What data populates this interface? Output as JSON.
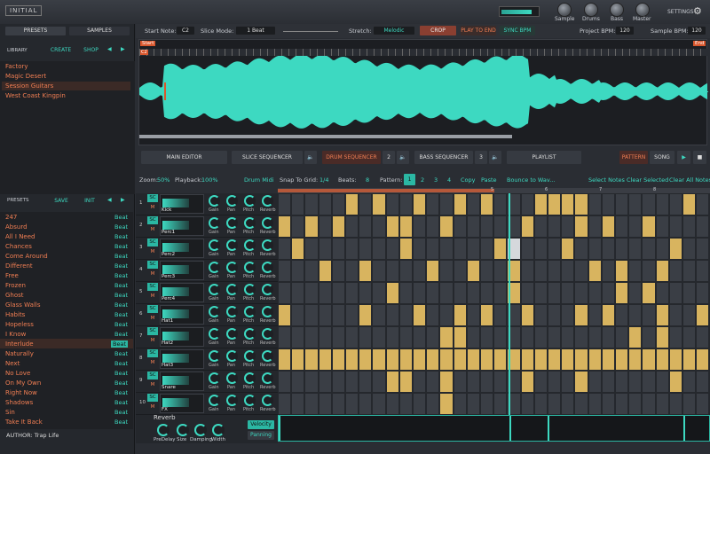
{
  "brand": "INITIAL",
  "header": {
    "knobs": [
      "Sample",
      "Drums",
      "Bass",
      "Master"
    ],
    "settings": "SETTINGS"
  },
  "left": {
    "tab_presets": "PRESETS",
    "tab_samples": "SAMPLES",
    "library_label": "LIBRARY",
    "create": "CREATE",
    "shop": "SHOP",
    "library": [
      "Factory",
      "Magic Desert",
      "Session Guitars",
      "West Coast Kingpin"
    ],
    "presets_label": "PRESETS",
    "save": "SAVE",
    "init": "INIT",
    "presets": [
      {
        "n": "247",
        "t": "Beat"
      },
      {
        "n": "Absurd",
        "t": "Beat"
      },
      {
        "n": "All I Need",
        "t": "Beat"
      },
      {
        "n": "Chances",
        "t": "Beat"
      },
      {
        "n": "Come Around",
        "t": "Beat"
      },
      {
        "n": "Different",
        "t": "Beat"
      },
      {
        "n": "Free",
        "t": "Beat"
      },
      {
        "n": "Frozen",
        "t": "Beat"
      },
      {
        "n": "Ghost",
        "t": "Beat"
      },
      {
        "n": "Glass Walls",
        "t": "Beat"
      },
      {
        "n": "Habits",
        "t": "Beat"
      },
      {
        "n": "Hopeless",
        "t": "Beat"
      },
      {
        "n": "I Know",
        "t": "Beat"
      },
      {
        "n": "Interlude",
        "t": "Beat"
      },
      {
        "n": "Naturally",
        "t": "Beat"
      },
      {
        "n": "Next",
        "t": "Beat"
      },
      {
        "n": "No Love",
        "t": "Beat"
      },
      {
        "n": "On My Own",
        "t": "Beat"
      },
      {
        "n": "Right Now",
        "t": "Beat"
      },
      {
        "n": "Shadows",
        "t": "Beat"
      },
      {
        "n": "Sin",
        "t": "Beat"
      },
      {
        "n": "Take It Back",
        "t": "Beat"
      }
    ],
    "author": "AUTHOR: Trap Life"
  },
  "toolbar": {
    "start_note_label": "Start Note:",
    "start_note": "C2",
    "slice_mode_label": "Slice Mode:",
    "slice_mode": "1 Beat",
    "stretch_label": "Stretch:",
    "stretch": "Melodic",
    "crop": "CROP",
    "play_to_end": "PLAY TO END",
    "sync_bpm": "SYNC BPM",
    "project_bpm_label": "Project BPM:",
    "project_bpm": "120",
    "sample_bpm_label": "Sample BPM:",
    "sample_bpm": "120"
  },
  "wave": {
    "start": "Start",
    "end": "End",
    "note": "C2"
  },
  "nav": {
    "main_editor": "MAIN EDITOR",
    "slice_seq": "SLICE SEQUENCER",
    "drum_seq": "DRUM SEQUENCER",
    "drum_num": "2",
    "bass_seq": "BASS SEQUENCER",
    "bass_num": "3",
    "playlist": "PLAYLIST",
    "pattern": "PATTERN",
    "song": "SONG"
  },
  "seq_toolbar": {
    "zoom": "Zoom:",
    "zoom_val": "50%",
    "playback": "Playback:",
    "playback_val": "100%",
    "drum_midi": "Drum Midi",
    "snap": "Snap To Grid:",
    "snap_val": "1/4",
    "beats": "Beats:",
    "beats_val": "8",
    "pattern": "Pattern:",
    "patterns": [
      "1",
      "2",
      "3",
      "4"
    ],
    "copy": "Copy",
    "paste": "Paste",
    "bounce": "Bounce to Wav...",
    "select": "Select Notes",
    "clear_sel": "Clear Selected",
    "clear_all": "Clear All Notes"
  },
  "ruler": [
    "5",
    "6",
    "7",
    "8"
  ],
  "tracks": [
    {
      "num": "1",
      "name": "Kick"
    },
    {
      "num": "2",
      "name": "Perc1"
    },
    {
      "num": "3",
      "name": "Perc2"
    },
    {
      "num": "4",
      "name": "Perc3"
    },
    {
      "num": "5",
      "name": "Perc4"
    },
    {
      "num": "6",
      "name": "Hat1"
    },
    {
      "num": "7",
      "name": "Hat2"
    },
    {
      "num": "8",
      "name": "Hat3"
    },
    {
      "num": "9",
      "name": "Snare"
    },
    {
      "num": "10",
      "name": "FX"
    }
  ],
  "track_knobs": {
    "sc": "SC",
    "m": "M",
    "gain": "Gain",
    "pan": "Pan",
    "pitch": "Pitch",
    "reverb": "Reverb"
  },
  "fx": {
    "title": "Reverb",
    "predelay": "PreDelay",
    "size": "Size",
    "damping": "Damping",
    "width": "Width",
    "velocity": "Velocity",
    "panning": "Panning"
  }
}
